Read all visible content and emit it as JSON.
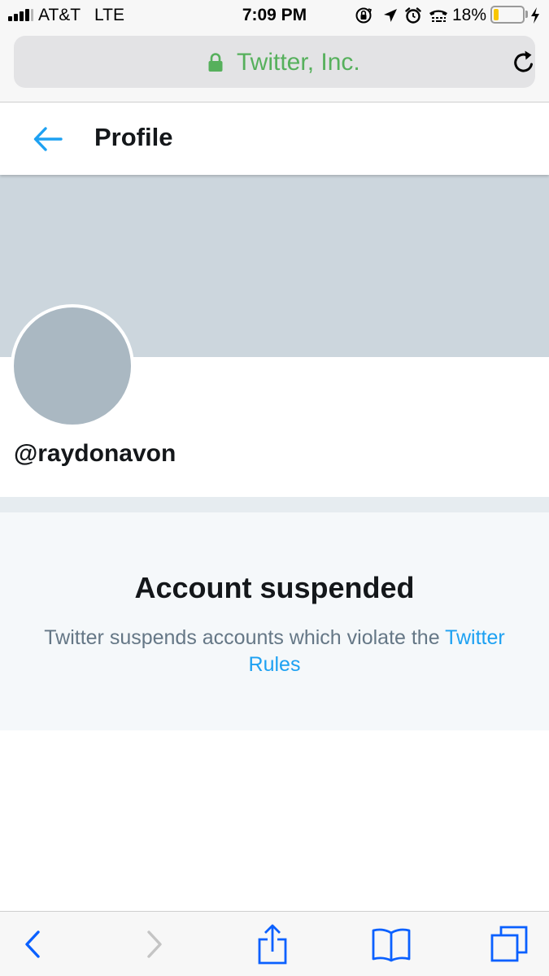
{
  "status_bar": {
    "carrier": "AT&T",
    "network": "LTE",
    "time": "7:09 PM",
    "battery_percent": "18%",
    "battery_level": 0.18,
    "icons": [
      "signal-bars-icon",
      "orientation-lock-icon",
      "location-arrow-icon",
      "alarm-clock-icon",
      "tty-icon",
      "battery-icon",
      "charging-bolt-icon"
    ]
  },
  "browser": {
    "url_label": "Twitter, Inc.",
    "secure_color": "#56b05c",
    "icons": [
      "lock-icon",
      "reload-icon"
    ]
  },
  "header": {
    "title": "Profile",
    "icons": [
      "back-arrow-icon"
    ],
    "accent": "#1da1f2"
  },
  "profile": {
    "handle": "@raydonavon",
    "banner_color": "#ccd6dd",
    "avatar_color": "#aab8c2"
  },
  "suspended": {
    "title": "Account suspended",
    "message": "Twitter suspends accounts which violate the ",
    "link_text": "Twitter Rules"
  },
  "toolbar": {
    "icons": [
      "back-chevron-icon",
      "forward-chevron-icon",
      "share-icon",
      "bookmarks-icon",
      "tabs-icon"
    ],
    "accent": "#0a60ff"
  }
}
